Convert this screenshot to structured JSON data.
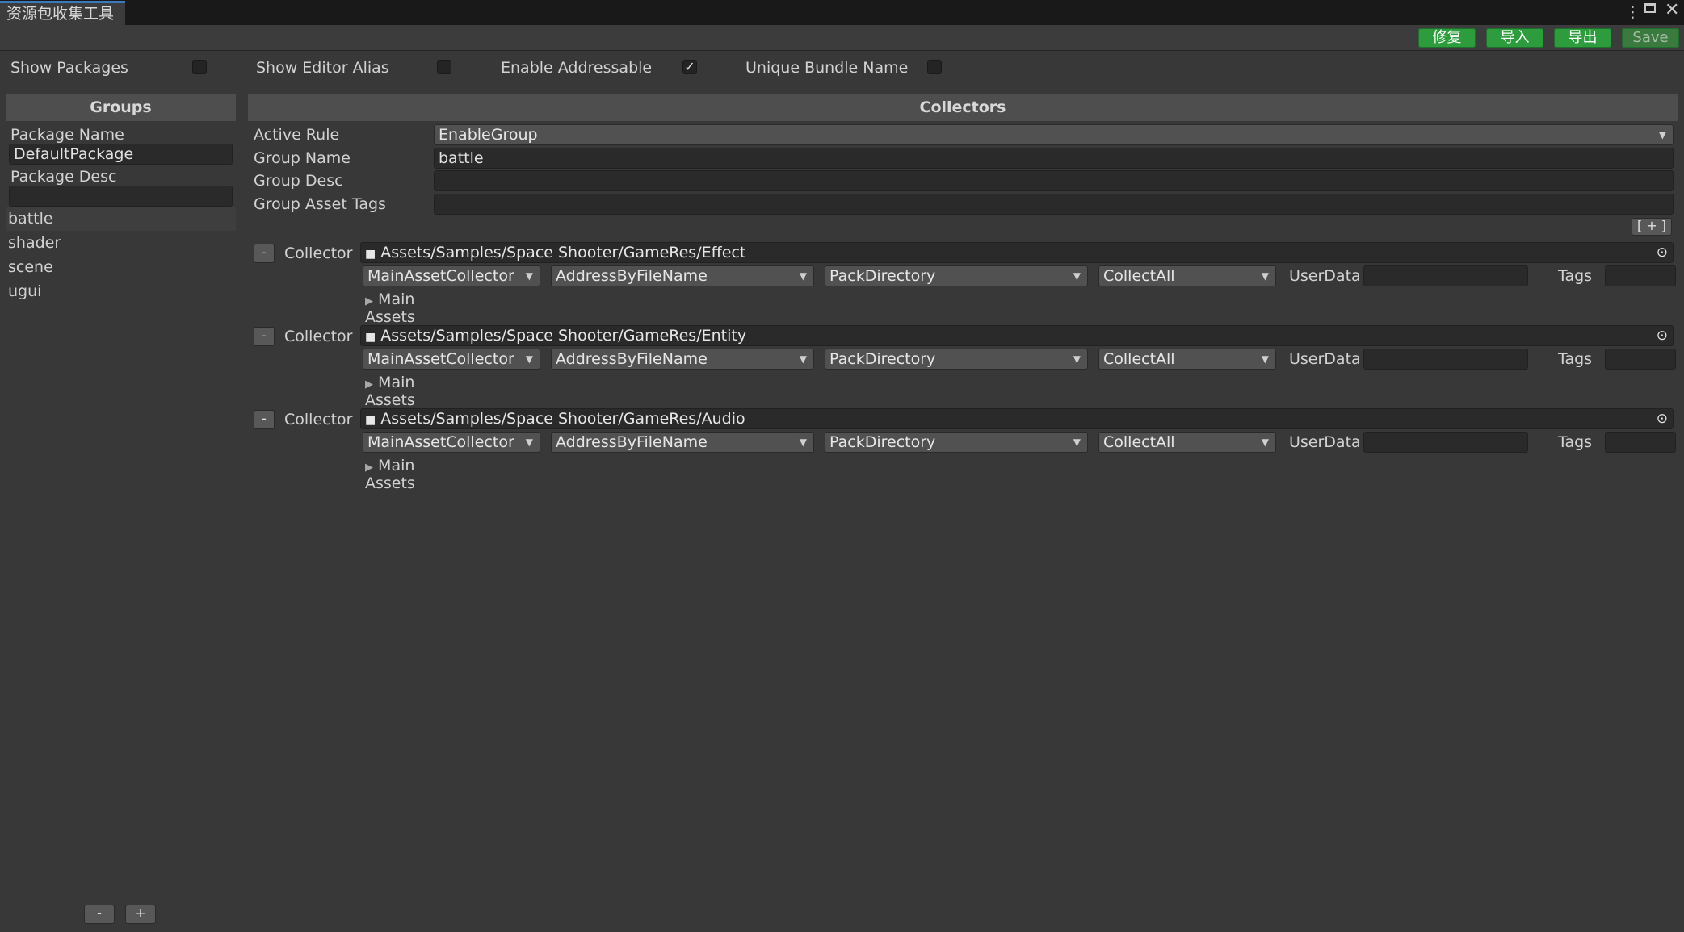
{
  "window": {
    "tab_title": "资源包收集工具",
    "menu_icon": "more-vert-icon",
    "maximize_icon": "maximize-icon",
    "close_icon": "close-icon"
  },
  "toolbar": {
    "repair_label": "修复",
    "import_label": "导入",
    "export_label": "导出",
    "save_label": "Save"
  },
  "options": {
    "show_packages": {
      "label": "Show Packages",
      "checked": false
    },
    "show_editor_alias": {
      "label": "Show Editor Alias",
      "checked": false
    },
    "enable_addressable": {
      "label": "Enable Addressable",
      "checked": true
    },
    "unique_bundle_name": {
      "label": "Unique Bundle Name",
      "checked": false
    }
  },
  "groups_panel": {
    "header": "Groups",
    "package_name_label": "Package Name",
    "package_name_value": "DefaultPackage",
    "package_desc_label": "Package Desc",
    "package_desc_value": "",
    "groups": [
      "battle",
      "shader",
      "scene",
      "ugui"
    ],
    "selected": "battle",
    "remove_label": "-",
    "add_label": "+"
  },
  "collectors_panel": {
    "header": "Collectors",
    "active_rule_label": "Active Rule",
    "active_rule_value": "EnableGroup",
    "group_name_label": "Group Name",
    "group_name_value": "battle",
    "group_desc_label": "Group Desc",
    "group_desc_value": "",
    "group_tags_label": "Group Asset Tags",
    "group_tags_value": "",
    "add_collector_label": "[ + ]",
    "collectors": [
      {
        "remove_label": "-",
        "label": "Collector",
        "path": "Assets/Samples/Space Shooter/GameRes/Effect",
        "collector_type": "MainAssetCollector",
        "address_rule": "AddressByFileName",
        "pack_rule": "PackDirectory",
        "filter_rule": "CollectAll",
        "userdata_label": "UserData",
        "userdata_value": "",
        "tags_label": "Tags",
        "tags_value": "",
        "main_assets_label": "Main Assets"
      },
      {
        "remove_label": "-",
        "label": "Collector",
        "path": "Assets/Samples/Space Shooter/GameRes/Entity",
        "collector_type": "MainAssetCollector",
        "address_rule": "AddressByFileName",
        "pack_rule": "PackDirectory",
        "filter_rule": "CollectAll",
        "userdata_label": "UserData",
        "userdata_value": "",
        "tags_label": "Tags",
        "tags_value": "",
        "main_assets_label": "Main Assets"
      },
      {
        "remove_label": "-",
        "label": "Collector",
        "path": "Assets/Samples/Space Shooter/GameRes/Audio",
        "collector_type": "MainAssetCollector",
        "address_rule": "AddressByFileName",
        "pack_rule": "PackDirectory",
        "filter_rule": "CollectAll",
        "userdata_label": "UserData",
        "userdata_value": "",
        "tags_label": "Tags",
        "tags_value": "",
        "main_assets_label": "Main Assets"
      }
    ]
  },
  "colors": {
    "background": "#383838",
    "header": "#4e4e4e",
    "button_green": "#2c9c3c",
    "tab_accent": "#3a79bb"
  }
}
